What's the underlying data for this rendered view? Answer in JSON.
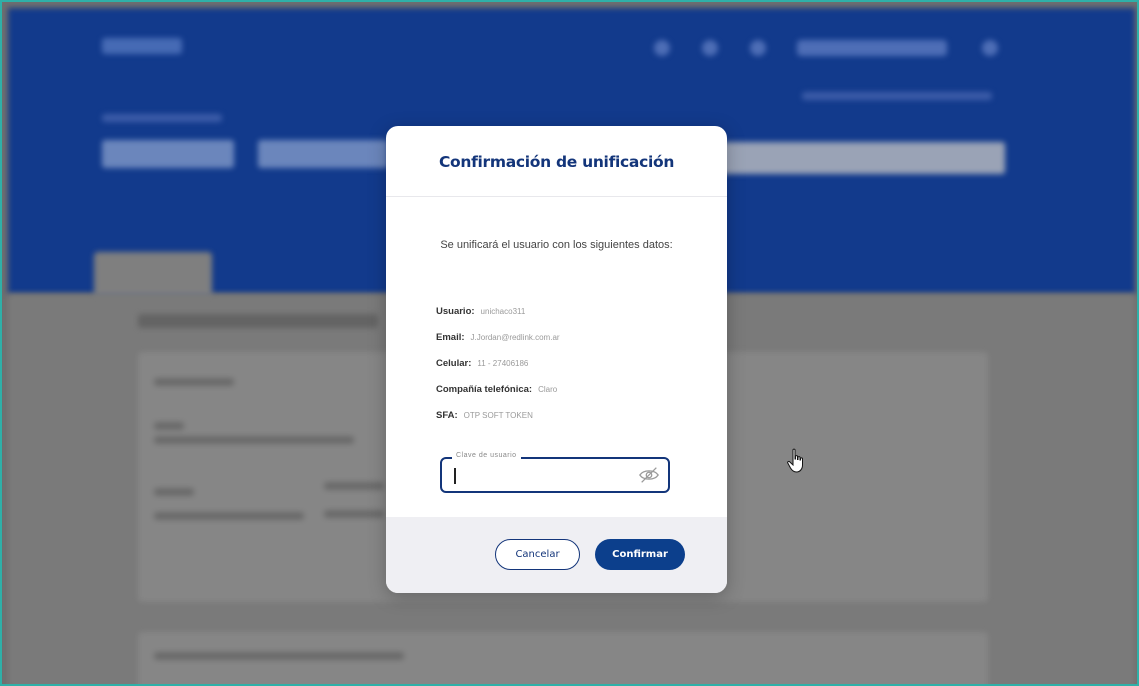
{
  "modal": {
    "title": "Confirmación de unificación",
    "intro": "Se unificará el usuario con los siguientes datos:",
    "fields": [
      {
        "label": "Usuario:",
        "value": "unichaco311"
      },
      {
        "label": "Email:",
        "value": "J.Jordan@redlink.com.ar"
      },
      {
        "label": "Celular:",
        "value": "11 - 27406186"
      },
      {
        "label": "Compañía telefónica:",
        "value": "Claro"
      },
      {
        "label": "SFA:",
        "value": "OTP SOFT TOKEN"
      }
    ],
    "password": {
      "label": "Clave de usuario",
      "value": "",
      "visibility_icon": "eye-slash-icon"
    },
    "buttons": {
      "cancel": "Cancelar",
      "confirm": "Confirmar"
    }
  },
  "colors": {
    "header_blue": "#123a8c",
    "primary": "#0c3f8c",
    "title": "#13357a",
    "overlay": "#7a7a7a"
  }
}
